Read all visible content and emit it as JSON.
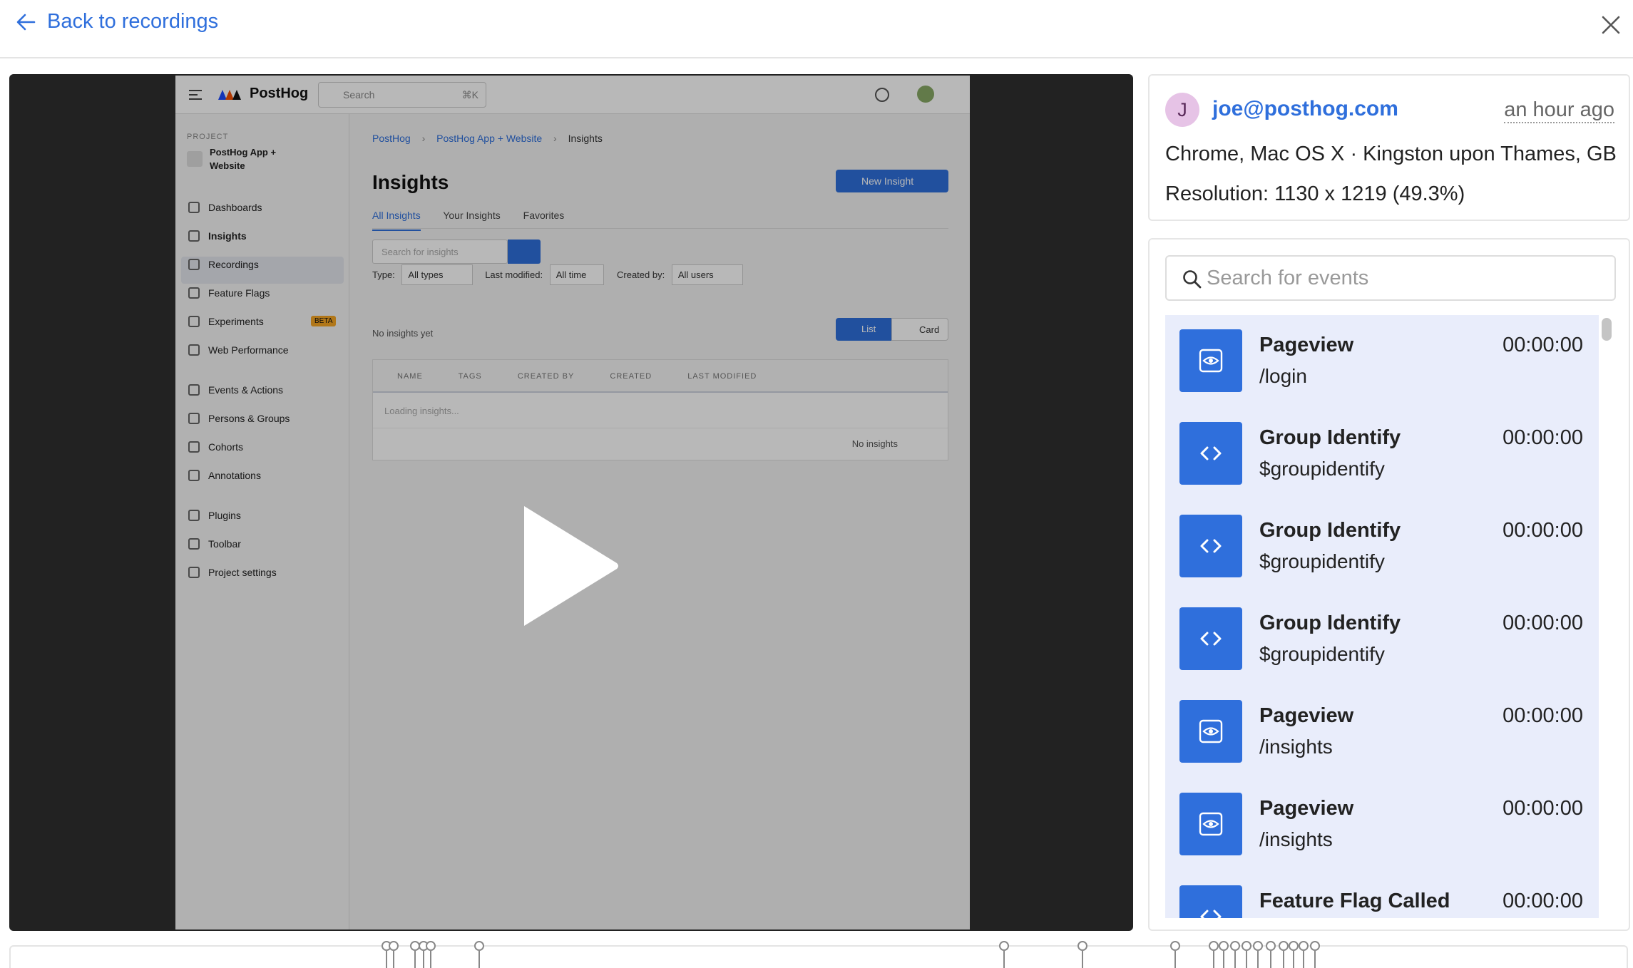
{
  "header": {
    "back_label": "Back to recordings"
  },
  "recording_frame": {
    "app_name": "PostHog",
    "search_placeholder": "Search",
    "search_shortcut": "⌘K",
    "project_section": "PROJECT",
    "project_name": "PostHog App + Website",
    "nav": [
      {
        "label": "Dashboards",
        "icon": "dashboard-icon"
      },
      {
        "label": "Insights",
        "icon": "insights-icon"
      },
      {
        "label": "Recordings",
        "icon": "recordings-icon"
      },
      {
        "label": "Feature Flags",
        "icon": "flag-icon"
      },
      {
        "label": "Experiments",
        "icon": "flask-icon",
        "badge": "BETA"
      },
      {
        "label": "Web Performance",
        "icon": "coffee-icon"
      },
      {
        "label": "Events & Actions",
        "icon": "events-icon"
      },
      {
        "label": "Persons & Groups",
        "icon": "person-icon"
      },
      {
        "label": "Cohorts",
        "icon": "cohorts-icon"
      },
      {
        "label": "Annotations",
        "icon": "annotation-icon"
      },
      {
        "label": "Plugins",
        "icon": "plugin-icon"
      },
      {
        "label": "Toolbar",
        "icon": "tools-icon"
      },
      {
        "label": "Project settings",
        "icon": "settings-icon"
      }
    ],
    "breadcrumb": [
      "PostHog",
      "PostHog App + Website",
      "Insights"
    ],
    "page_title": "Insights",
    "new_insight_label": "New Insight",
    "tabs": [
      "All Insights",
      "Your Insights",
      "Favorites"
    ],
    "search_insights_placeholder": "Search for insights",
    "filters": {
      "type_label": "Type:",
      "type_value": "All types",
      "modified_label": "Last modified:",
      "modified_value": "All time",
      "created_label": "Created by:",
      "created_value": "All users"
    },
    "empty_text": "No insights yet",
    "view_list": "List",
    "view_card": "Card",
    "table_columns": [
      "NAME",
      "TAGS",
      "CREATED BY",
      "CREATED",
      "LAST MODIFIED"
    ],
    "loading_text": "Loading insights...",
    "footer_text": "No insights"
  },
  "session": {
    "avatar_letter": "J",
    "email": "joe@posthog.com",
    "time_ago": "an hour ago",
    "device": "Chrome, Mac OS X · Kingston upon Thames, GB",
    "resolution": "Resolution: 1130 x 1219 (49.3%)"
  },
  "events": {
    "search_placeholder": "Search for events",
    "items": [
      {
        "name": "Pageview",
        "detail": "/login",
        "time": "00:00:00",
        "icon": "eye-icon"
      },
      {
        "name": "Group Identify",
        "detail": "$groupidentify",
        "time": "00:00:00",
        "icon": "code-icon"
      },
      {
        "name": "Group Identify",
        "detail": "$groupidentify",
        "time": "00:00:00",
        "icon": "code-icon"
      },
      {
        "name": "Group Identify",
        "detail": "$groupidentify",
        "time": "00:00:00",
        "icon": "code-icon"
      },
      {
        "name": "Pageview",
        "detail": "/insights",
        "time": "00:00:00",
        "icon": "eye-icon"
      },
      {
        "name": "Pageview",
        "detail": "/insights",
        "time": "00:00:00",
        "icon": "eye-icon"
      },
      {
        "name": "Feature Flag Called",
        "detail": "",
        "time": "00:00:00",
        "icon": "code-icon"
      }
    ]
  },
  "colors": {
    "accent": "#2f6fdc",
    "event_list_bg": "#e9edfb",
    "player_bg": "#222222"
  }
}
